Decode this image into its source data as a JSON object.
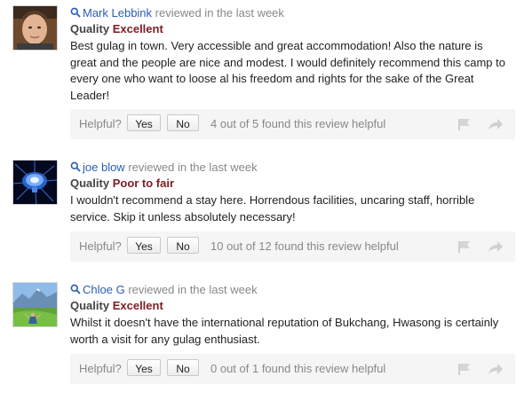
{
  "reviews": [
    {
      "author": "Mark Lebbink",
      "meta": "reviewed in the last week",
      "quality_label": "Quality",
      "quality_value": "Excellent",
      "body_lines": [
        "Best gulag in town. Very accessible and great accommodation! Also the nature is",
        "great and the people are nice and modest. I would definitely recommend this camp to",
        "every one who want to loose al his freedom and rights for the sake of the Great",
        "Leader!"
      ],
      "helpful_label": "Helpful?",
      "yes_label": "Yes",
      "no_label": "No",
      "helpful_count": "4 out of 5 found this review helpful",
      "avatar": "portrait-photo"
    },
    {
      "author": "joe blow",
      "meta": "reviewed in the last week",
      "quality_label": "Quality",
      "quality_value": "Poor to fair",
      "body_lines": [
        "I wouldn't recommend a stay here. Horrendous facilities, uncaring staff, horrible",
        "service. Skip it unless absolutely necessary!"
      ],
      "helpful_label": "Helpful?",
      "yes_label": "Yes",
      "no_label": "No",
      "helpful_count": "10 out of 12 found this review helpful",
      "avatar": "glowing-brain-image"
    },
    {
      "author": "Chloe G",
      "meta": "reviewed in the last week",
      "quality_label": "Quality",
      "quality_value": "Excellent",
      "body_lines": [
        "Whilst it doesn't have the international reputation of Bukchang, Hwasong is certainly",
        "worth a visit for any gulag enthusiast."
      ],
      "helpful_label": "Helpful?",
      "yes_label": "Yes",
      "no_label": "No",
      "helpful_count": "0 out of 1 found this review helpful",
      "avatar": "mountain-meadow-photo"
    }
  ],
  "colors": {
    "author_link": "#2a5db0",
    "quality_value": "#7d1d25",
    "muted_text": "#888888",
    "feedback_bar": "#f5f5f5"
  },
  "icons": {
    "author_prefix": "search-icon",
    "report": "flag-icon",
    "share": "share-arrow-icon"
  }
}
